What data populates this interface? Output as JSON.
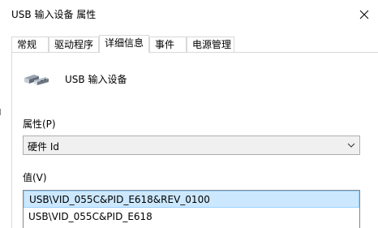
{
  "window": {
    "title": "USB 输入设备 属性"
  },
  "tabs": [
    {
      "label": "常规"
    },
    {
      "label": "驱动程序"
    },
    {
      "label": "详细信息"
    },
    {
      "label": "事件"
    },
    {
      "label": "电源管理"
    }
  ],
  "device": {
    "name": "USB 输入设备",
    "icon": "usb-plug-icon"
  },
  "property": {
    "label": "属性(P)",
    "selected": "硬件 Id"
  },
  "value": {
    "label": "值(V)",
    "items": [
      "USB\\VID_055C&PID_E618&REV_0100",
      "USB\\VID_055C&PID_E618"
    ]
  },
  "colors": {
    "selection_bg": "#cce8ff",
    "selection_border": "#99d1ff"
  }
}
